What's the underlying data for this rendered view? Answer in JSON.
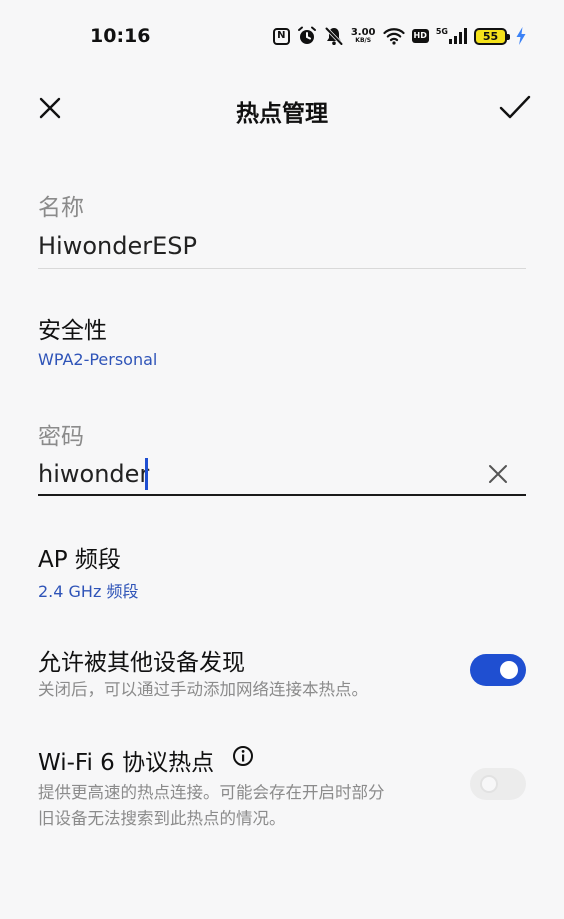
{
  "status_bar": {
    "time": "10:16",
    "nfc_label": "N",
    "speed_value": "3.00",
    "speed_unit": "KB/S",
    "hd_label": "HD",
    "network_label": "5G",
    "battery_level": "55",
    "icons": [
      "nfc-icon",
      "alarm-icon",
      "mute-icon",
      "wifi-icon",
      "hd-icon",
      "signal-icon",
      "battery-icon",
      "charging-icon"
    ]
  },
  "header": {
    "title": "热点管理",
    "close_icon": "close-icon",
    "confirm_icon": "checkmark-icon"
  },
  "name_field": {
    "label": "名称",
    "value": "HiwonderESP"
  },
  "security": {
    "title": "安全性",
    "value": "WPA2-Personal"
  },
  "password_field": {
    "label": "密码",
    "value": "hiwonder"
  },
  "ap_band": {
    "title": "AP 频段",
    "value": "2.4 GHz 频段"
  },
  "discoverable": {
    "title": "允许被其他设备发现",
    "description": "关闭后，可以通过手动添加网络连接本热点。",
    "enabled": true
  },
  "wifi6": {
    "title": "Wi-Fi 6 协议热点",
    "description_line1": "提供更高速的热点连接。可能会存在开启时部分",
    "description_line2": "旧设备无法搜索到此热点的情况。",
    "enabled": false
  },
  "colors": {
    "accent": "#1f4fd1",
    "link_blue": "#2f54b8",
    "muted_text": "#8b8b8b",
    "battery_yellow": "#f5e21b",
    "background": "#f7f7f8"
  }
}
